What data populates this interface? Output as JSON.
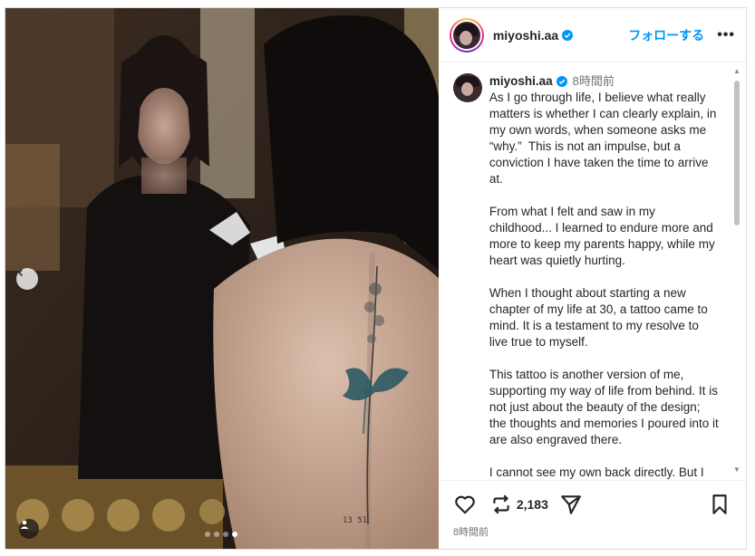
{
  "header": {
    "username": "miyoshi.aa",
    "follow_label": "フォローする",
    "more_label": "•••"
  },
  "caption": {
    "username": "miyoshi.aa",
    "time": "8時間前",
    "paragraphs": [
      "As I go through life, I believe what really matters is whether I can clearly explain, in my own words, when someone asks me “why.”  This is not an impulse, but a conviction I have taken the time to arrive at.",
      "From what I felt and saw in my childhood... I learned to endure more and more to keep my parents happy, while my heart was quietly hurting.",
      "When I thought about starting a new chapter of my life at 30, a tattoo came to mind. It is a testament to my resolve to live true to myself.",
      "This tattoo is another version of me, supporting my way of life from behind. It is not just about the beauty of the design; the thoughts and memories I poured into it are also engraved there.",
      "I cannot see my own back directly. But I"
    ]
  },
  "actions": {
    "repost_count": "2,183",
    "post_time": "8時間前"
  },
  "media": {
    "tattoo_text": "13 51",
    "dots_total": 4,
    "active_dot": 4
  },
  "icons": {
    "prev": "chevron-left-icon",
    "tag": "user-tag-icon",
    "like": "heart-icon",
    "repost": "repost-icon",
    "share": "send-icon",
    "save": "bookmark-icon",
    "verified": "verified-badge-icon"
  },
  "colors": {
    "accent": "#0095f6",
    "verified": "#0095f6"
  }
}
